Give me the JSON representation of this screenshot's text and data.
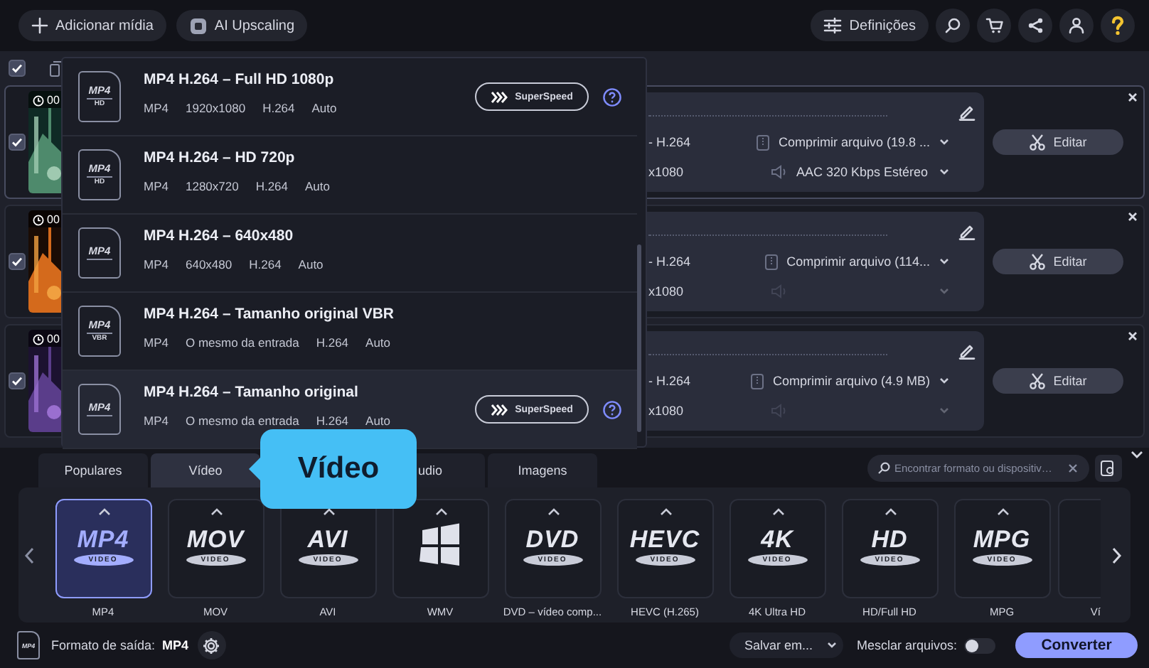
{
  "toolbar": {
    "buttons": [
      {
        "kind": "add",
        "label": "Adicionar mídia"
      },
      {
        "kind": "ai",
        "label": "AI Upscaling"
      }
    ],
    "settings": "Definições",
    "icons": [
      {
        "kind": "search"
      },
      {
        "kind": "cart"
      },
      {
        "kind": "share"
      },
      {
        "kind": "user"
      },
      {
        "kind": "help"
      }
    ]
  },
  "list": {
    "all_checked": true,
    "files": [
      {
        "checked": true,
        "selected": true,
        "time": "00",
        "codec": "- H.264",
        "resolution": "x1080",
        "compress": "Comprimir arquivo (19.8 ...",
        "audio": {
          "enabled": true,
          "label": "AAC 320 Kbps Estéreo"
        },
        "edit": "Editar"
      },
      {
        "checked": true,
        "selected": false,
        "time": "00",
        "codec": "- H.264",
        "resolution": "x1080",
        "compress": "Comprimir arquivo (114...",
        "audio": {
          "enabled": false
        },
        "edit": "Editar"
      },
      {
        "checked": true,
        "selected": false,
        "time": "00",
        "codec": "- H.264",
        "resolution": "x1080",
        "compress": "Comprimir arquivo (4.9 MB)",
        "audio": {
          "enabled": false
        },
        "edit": "Editar"
      }
    ]
  },
  "presets": [
    {
      "icon_label": "MP4",
      "icon_sub": "HD",
      "title": "MP4 H.264 – Full HD 1080p",
      "specs": [
        "MP4",
        "1920x1080",
        "H.264",
        "Auto"
      ],
      "superspeed": "SuperSpeed",
      "selected": false
    },
    {
      "icon_label": "MP4",
      "icon_sub": "HD",
      "title": "MP4 H.264 – HD 720p",
      "specs": [
        "MP4",
        "1280x720",
        "H.264",
        "Auto"
      ],
      "selected": false
    },
    {
      "icon_label": "MP4",
      "title": "MP4 H.264 – 640x480",
      "specs": [
        "MP4",
        "640x480",
        "H.264",
        "Auto"
      ],
      "selected": false
    },
    {
      "icon_label": "MP4",
      "icon_sub": "VBR",
      "title": "MP4 H.264 – Tamanho original VBR",
      "specs": [
        "MP4",
        "O mesmo da entrada",
        "H.264",
        "Auto"
      ],
      "selected": false
    },
    {
      "icon_label": "MP4",
      "title": "MP4 H.264 – Tamanho original",
      "specs": [
        "MP4",
        "O mesmo da entrada",
        "H.264",
        "Auto"
      ],
      "superspeed": "SuperSpeed",
      "selected": true
    }
  ],
  "tabs": [
    {
      "label": "Populares",
      "selected": false
    },
    {
      "label": "Vídeo",
      "selected": true
    },
    {
      "label": "udio",
      "selected": false
    },
    {
      "label": "Imagens",
      "selected": false
    }
  ],
  "tooltip": "Vídeo",
  "search": {
    "placeholder": "Encontrar formato ou dispositiv…"
  },
  "formats": [
    {
      "kind": "text",
      "logo": "MP4",
      "badge": "VIDEO",
      "label": "MP4",
      "selected": true
    },
    {
      "kind": "text",
      "logo": "MOV",
      "badge": "VIDEO",
      "label": "MOV",
      "selected": false
    },
    {
      "kind": "text",
      "logo": "AVI",
      "badge": "VIDEO",
      "label": "AVI",
      "selected": false
    },
    {
      "kind": "windows",
      "label": "WMV",
      "selected": false
    },
    {
      "kind": "text",
      "logo": "DVD",
      "badge": "VIDEO",
      "label": "DVD – vídeo comp...",
      "selected": false
    },
    {
      "kind": "text",
      "logo": "HEVC",
      "badge": "VIDEO",
      "label": "HEVC (H.265)",
      "selected": false
    },
    {
      "kind": "text",
      "logo": "4K",
      "badge": "VIDEO",
      "label": "4K Ultra HD",
      "selected": false
    },
    {
      "kind": "text",
      "logo": "HD",
      "badge": "VIDEO",
      "label": "HD/Full HD",
      "selected": false
    },
    {
      "kind": "text",
      "logo": "MPG",
      "badge": "VIDEO",
      "label": "MPG",
      "selected": false
    },
    {
      "kind": "partial",
      "label": "Ví",
      "selected": false
    }
  ],
  "footer": {
    "file_icon_label": "MP4",
    "output_label": "Formato de saída:",
    "output_value": "MP4",
    "save": "Salvar em...",
    "merge_label": "Mesclar arquivos:",
    "merge_on": false,
    "convert": "Converter"
  }
}
